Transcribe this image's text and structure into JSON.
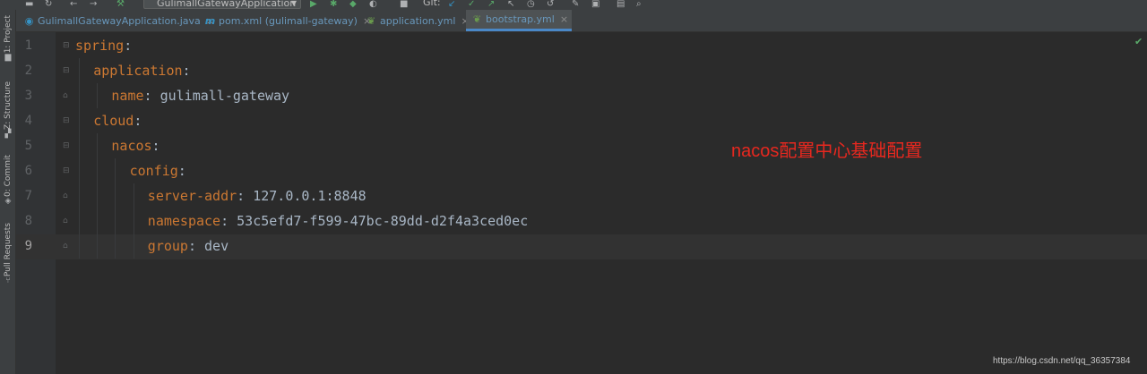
{
  "toolbar": {
    "run_config": "GulimallGatewayApplication",
    "git_label": "Git:",
    "icons": [
      "save-icon",
      "sync-icon",
      "back-icon",
      "forward-icon",
      "hammer-icon",
      "run-icon",
      "debug-icon",
      "coverage-icon",
      "profile-icon",
      "stop-icon",
      "git-update-icon",
      "git-commit-icon",
      "git-push-icon",
      "git-history-icon",
      "revert-icon",
      "wrench-icon",
      "project-structure-icon",
      "search-icon"
    ]
  },
  "sidebar": {
    "items": [
      {
        "label": "1: Project",
        "icon": "folder-icon"
      },
      {
        "label": "Z: Structure",
        "icon": "structure-icon"
      },
      {
        "label": "0: Commit",
        "icon": "commit-icon"
      },
      {
        "label": "Pull Requests",
        "icon": "pull-request-icon"
      }
    ]
  },
  "tabs": [
    {
      "label": "GulimallGatewayApplication.java",
      "icon": "java-class-icon",
      "active": false
    },
    {
      "label": "pom.xml (gulimall-gateway)",
      "icon": "maven-icon",
      "active": false
    },
    {
      "label": "application.yml",
      "icon": "spring-yml-icon",
      "active": false
    },
    {
      "label": "bootstrap.yml",
      "icon": "spring-yml-icon",
      "active": true
    }
  ],
  "editor": {
    "current_line": 9,
    "lines": [
      {
        "n": "1",
        "indent": 0,
        "key": "spring",
        "colon": ":",
        "value": ""
      },
      {
        "n": "2",
        "indent": 1,
        "key": "application",
        "colon": ":",
        "value": ""
      },
      {
        "n": "3",
        "indent": 2,
        "key": "name",
        "colon": ":",
        "value": " gulimall-gateway"
      },
      {
        "n": "4",
        "indent": 1,
        "key": "cloud",
        "colon": ":",
        "value": ""
      },
      {
        "n": "5",
        "indent": 2,
        "key": "nacos",
        "colon": ":",
        "value": ""
      },
      {
        "n": "6",
        "indent": 3,
        "key": "config",
        "colon": ":",
        "value": ""
      },
      {
        "n": "7",
        "indent": 4,
        "key": "server-addr",
        "colon": ":",
        "value": " 127.0.0.1:8848"
      },
      {
        "n": "8",
        "indent": 4,
        "key": "namespace",
        "colon": ":",
        "value": " 53c5efd7-f599-47bc-89dd-d2f4a3ced0ec"
      },
      {
        "n": "9",
        "indent": 4,
        "key": "group",
        "colon": ":",
        "value": " dev"
      }
    ]
  },
  "annotation": "nacos配置中心基础配置",
  "watermark": "https://blog.csdn.net/qq_36357384",
  "colors": {
    "yaml_key": "#cc7832",
    "yaml_value": "#a9b7c6",
    "annotation": "#e8281f",
    "active_tab_underline": "#4a88c7"
  }
}
